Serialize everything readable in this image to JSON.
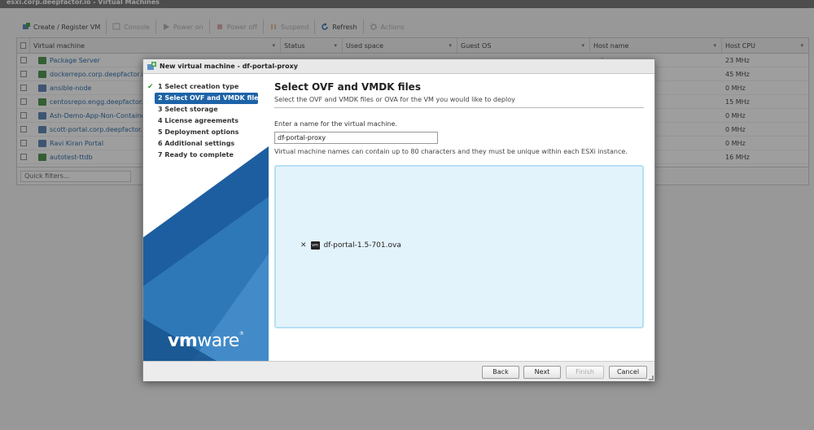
{
  "window": {
    "title": "esxi.corp.deepfactor.io - Virtual Machines"
  },
  "toolbar": {
    "create_register": "Create / Register VM",
    "console": "Console",
    "power_on": "Power on",
    "power_off": "Power off",
    "suspend": "Suspend",
    "refresh": "Refresh",
    "actions": "Actions"
  },
  "grid": {
    "columns": [
      "Virtual machine",
      "Status",
      "Used space",
      "Guest OS",
      "Host name",
      "Host CPU"
    ],
    "rows": [
      {
        "name": "Package Server",
        "host": "or.io",
        "cpu": "23 MHz",
        "state": "on"
      },
      {
        "name": "dockerrepo.corp.deepfactor.io",
        "host": "",
        "cpu": "45 MHz",
        "state": "on"
      },
      {
        "name": "ansible-node",
        "host": "",
        "cpu": "0 MHz",
        "state": "off"
      },
      {
        "name": "centosrepo.engg.deepfactor.io",
        "host": "pfactor.io",
        "cpu": "15 MHz",
        "state": "on"
      },
      {
        "name": "Ash-Demo-App-Non-Containeriz",
        "host": "",
        "cpu": "0 MHz",
        "state": "off"
      },
      {
        "name": "scott-portal.corp.deepfactor.io",
        "host": "",
        "cpu": "0 MHz",
        "state": "off"
      },
      {
        "name": "Ravi Kiran Portal",
        "host": "",
        "cpu": "0 MHz",
        "state": "off"
      },
      {
        "name": "autotest-ttdb",
        "host": "",
        "cpu": "16 MHz",
        "state": "on"
      }
    ],
    "quick_filters": "Quick filters..."
  },
  "dialog": {
    "title": "New virtual machine - df-portal-proxy",
    "steps": [
      {
        "label": "1 Select creation type",
        "status": "done"
      },
      {
        "label": "2 Select OVF and VMDK files",
        "status": "active"
      },
      {
        "label": "3 Select storage",
        "status": "pending"
      },
      {
        "label": "4 License agreements",
        "status": "pending"
      },
      {
        "label": "5 Deployment options",
        "status": "pending"
      },
      {
        "label": "6 Additional settings",
        "status": "pending"
      },
      {
        "label": "7 Ready to complete",
        "status": "pending"
      }
    ],
    "logo": {
      "bold": "vm",
      "rest": "ware",
      "mark": "®"
    },
    "heading": "Select OVF and VMDK files",
    "subheading": "Select the OVF and VMDK files or OVA for the VM you would like to deploy",
    "name_label": "Enter a name for the virtual machine.",
    "name_value": "df-portal-proxy",
    "name_hint": "Virtual machine names can contain up to 80 characters and they must be unique within each ESXi instance.",
    "file": {
      "icon_text": "vm",
      "name": "df-portal-1.5-701.ova"
    },
    "buttons": {
      "back": "Back",
      "next": "Next",
      "finish": "Finish",
      "cancel": "Cancel"
    }
  },
  "colors": {
    "accent_blue": "#1e63a8",
    "drop_zone": "#e3f3fb",
    "check_green": "#3a9a3a"
  }
}
